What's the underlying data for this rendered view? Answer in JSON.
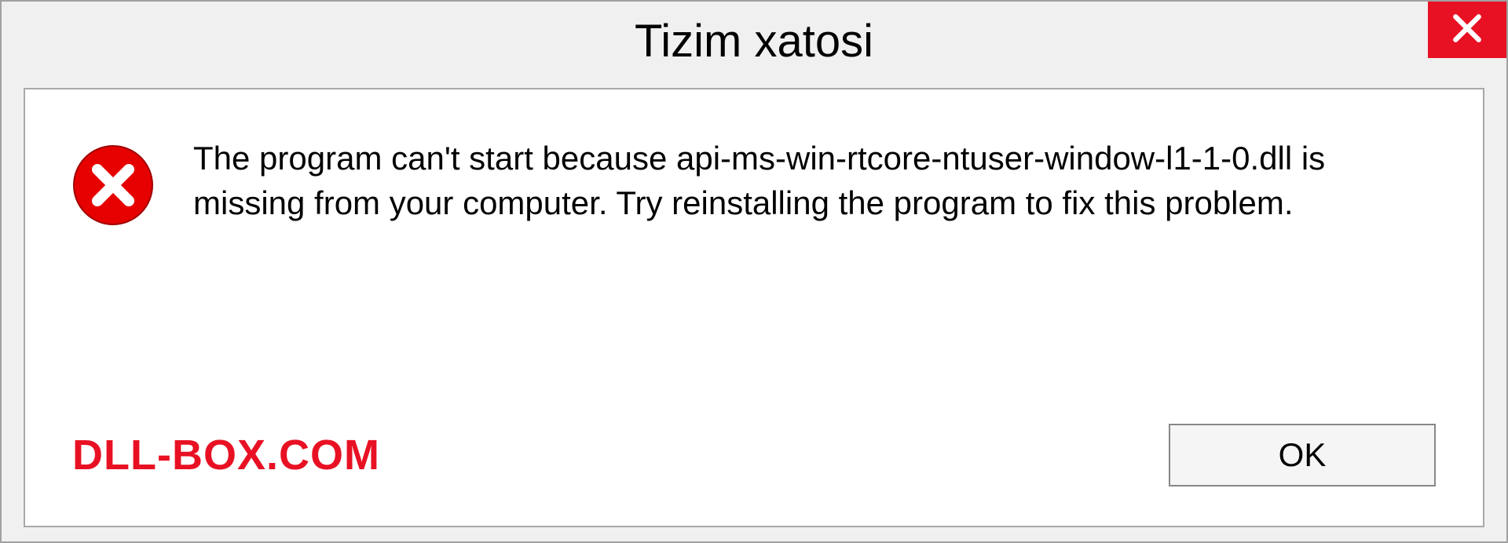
{
  "titlebar": {
    "title": "Tizim xatosi"
  },
  "message": {
    "text": "The program can't start because api-ms-win-rtcore-ntuser-window-l1-1-0.dll is missing from your computer. Try reinstalling the program to fix this problem."
  },
  "footer": {
    "watermark": "DLL-BOX.COM",
    "ok_label": "OK"
  },
  "icons": {
    "close": "close-icon",
    "error": "error-icon"
  },
  "colors": {
    "error_red": "#e81123",
    "bg": "#f0f0f0",
    "border": "#a8a8a8"
  }
}
